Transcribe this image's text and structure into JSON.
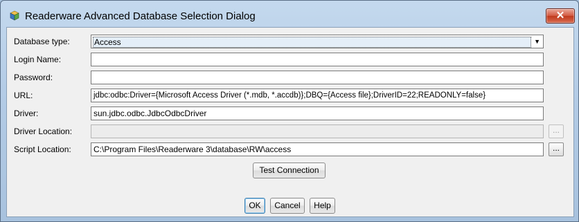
{
  "window": {
    "title": "Readerware Advanced Database Selection Dialog",
    "close_glyph": "✕"
  },
  "form": {
    "database_type": {
      "label": "Database type:",
      "value": "Access"
    },
    "login_name": {
      "label": "Login Name:",
      "value": ""
    },
    "password": {
      "label": "Password:",
      "value": ""
    },
    "url": {
      "label": "URL:",
      "value": "jdbc:odbc:Driver={Microsoft Access Driver (*.mdb, *.accdb)};DBQ={Access file};DriverID=22;READONLY=false}"
    },
    "driver": {
      "label": "Driver:",
      "value": "sun.jdbc.odbc.JdbcOdbcDriver"
    },
    "driver_location": {
      "label": "Driver Location:",
      "value": "",
      "browse": "..."
    },
    "script_location": {
      "label": "Script Location:",
      "value": "C:\\Program Files\\Readerware 3\\database\\RW\\access",
      "browse": "..."
    }
  },
  "buttons": {
    "test_connection": "Test Connection",
    "ok": "OK",
    "cancel": "Cancel",
    "help": "Help"
  },
  "icons": {
    "app": "app-icon",
    "dropdown": "chevron-down-icon",
    "close": "close-icon"
  }
}
